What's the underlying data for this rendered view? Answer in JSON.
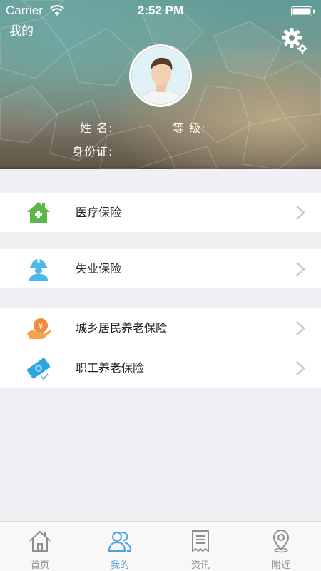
{
  "status_bar": {
    "carrier": "Carrier",
    "time": "2:52 PM"
  },
  "header": {
    "title": "我的",
    "name_label": "姓 名:",
    "level_label": "等 级:",
    "id_label": "身份证:"
  },
  "menu": {
    "groups": [
      {
        "items": [
          {
            "label": "医疗保险",
            "icon": "house-medical-icon"
          }
        ]
      },
      {
        "items": [
          {
            "label": "失业保险",
            "icon": "worker-icon"
          }
        ]
      },
      {
        "items": [
          {
            "label": "城乡居民养老保险",
            "icon": "hand-coin-icon"
          },
          {
            "label": "职工养老保险",
            "icon": "banknote-icon"
          }
        ]
      }
    ]
  },
  "tabbar": {
    "tabs": [
      {
        "label": "首页",
        "icon": "home-icon",
        "active": false
      },
      {
        "label": "我的",
        "icon": "users-icon",
        "active": true
      },
      {
        "label": "资讯",
        "icon": "news-icon",
        "active": false
      },
      {
        "label": "附近",
        "icon": "location-pin-icon",
        "active": false
      }
    ]
  },
  "colors": {
    "accent": "#4aa3df",
    "inactive_tab": "#8e8e93",
    "medical_icon": "#5ab847",
    "worker_icon": "#4bb8e8",
    "coin_icon": "#f08a3c",
    "banknote_icon": "#2fa6e0"
  }
}
